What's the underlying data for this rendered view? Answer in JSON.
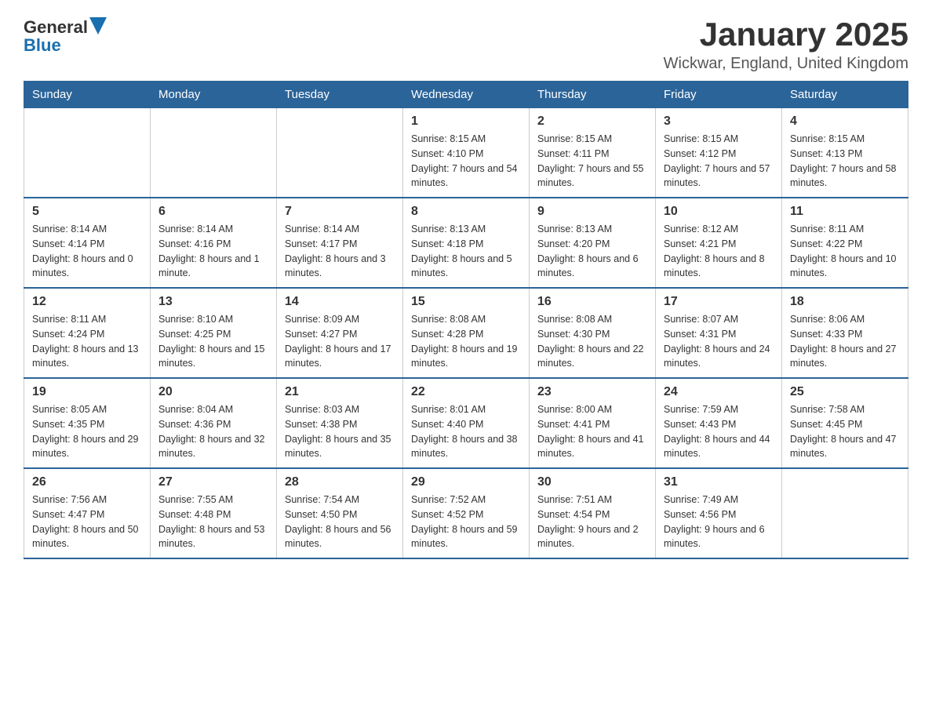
{
  "logo": {
    "text_general": "General",
    "text_blue": "Blue"
  },
  "title": "January 2025",
  "subtitle": "Wickwar, England, United Kingdom",
  "days_of_week": [
    "Sunday",
    "Monday",
    "Tuesday",
    "Wednesday",
    "Thursday",
    "Friday",
    "Saturday"
  ],
  "weeks": [
    [
      {
        "day": "",
        "info": ""
      },
      {
        "day": "",
        "info": ""
      },
      {
        "day": "",
        "info": ""
      },
      {
        "day": "1",
        "info": "Sunrise: 8:15 AM\nSunset: 4:10 PM\nDaylight: 7 hours\nand 54 minutes."
      },
      {
        "day": "2",
        "info": "Sunrise: 8:15 AM\nSunset: 4:11 PM\nDaylight: 7 hours\nand 55 minutes."
      },
      {
        "day": "3",
        "info": "Sunrise: 8:15 AM\nSunset: 4:12 PM\nDaylight: 7 hours\nand 57 minutes."
      },
      {
        "day": "4",
        "info": "Sunrise: 8:15 AM\nSunset: 4:13 PM\nDaylight: 7 hours\nand 58 minutes."
      }
    ],
    [
      {
        "day": "5",
        "info": "Sunrise: 8:14 AM\nSunset: 4:14 PM\nDaylight: 8 hours\nand 0 minutes."
      },
      {
        "day": "6",
        "info": "Sunrise: 8:14 AM\nSunset: 4:16 PM\nDaylight: 8 hours\nand 1 minute."
      },
      {
        "day": "7",
        "info": "Sunrise: 8:14 AM\nSunset: 4:17 PM\nDaylight: 8 hours\nand 3 minutes."
      },
      {
        "day": "8",
        "info": "Sunrise: 8:13 AM\nSunset: 4:18 PM\nDaylight: 8 hours\nand 5 minutes."
      },
      {
        "day": "9",
        "info": "Sunrise: 8:13 AM\nSunset: 4:20 PM\nDaylight: 8 hours\nand 6 minutes."
      },
      {
        "day": "10",
        "info": "Sunrise: 8:12 AM\nSunset: 4:21 PM\nDaylight: 8 hours\nand 8 minutes."
      },
      {
        "day": "11",
        "info": "Sunrise: 8:11 AM\nSunset: 4:22 PM\nDaylight: 8 hours\nand 10 minutes."
      }
    ],
    [
      {
        "day": "12",
        "info": "Sunrise: 8:11 AM\nSunset: 4:24 PM\nDaylight: 8 hours\nand 13 minutes."
      },
      {
        "day": "13",
        "info": "Sunrise: 8:10 AM\nSunset: 4:25 PM\nDaylight: 8 hours\nand 15 minutes."
      },
      {
        "day": "14",
        "info": "Sunrise: 8:09 AM\nSunset: 4:27 PM\nDaylight: 8 hours\nand 17 minutes."
      },
      {
        "day": "15",
        "info": "Sunrise: 8:08 AM\nSunset: 4:28 PM\nDaylight: 8 hours\nand 19 minutes."
      },
      {
        "day": "16",
        "info": "Sunrise: 8:08 AM\nSunset: 4:30 PM\nDaylight: 8 hours\nand 22 minutes."
      },
      {
        "day": "17",
        "info": "Sunrise: 8:07 AM\nSunset: 4:31 PM\nDaylight: 8 hours\nand 24 minutes."
      },
      {
        "day": "18",
        "info": "Sunrise: 8:06 AM\nSunset: 4:33 PM\nDaylight: 8 hours\nand 27 minutes."
      }
    ],
    [
      {
        "day": "19",
        "info": "Sunrise: 8:05 AM\nSunset: 4:35 PM\nDaylight: 8 hours\nand 29 minutes."
      },
      {
        "day": "20",
        "info": "Sunrise: 8:04 AM\nSunset: 4:36 PM\nDaylight: 8 hours\nand 32 minutes."
      },
      {
        "day": "21",
        "info": "Sunrise: 8:03 AM\nSunset: 4:38 PM\nDaylight: 8 hours\nand 35 minutes."
      },
      {
        "day": "22",
        "info": "Sunrise: 8:01 AM\nSunset: 4:40 PM\nDaylight: 8 hours\nand 38 minutes."
      },
      {
        "day": "23",
        "info": "Sunrise: 8:00 AM\nSunset: 4:41 PM\nDaylight: 8 hours\nand 41 minutes."
      },
      {
        "day": "24",
        "info": "Sunrise: 7:59 AM\nSunset: 4:43 PM\nDaylight: 8 hours\nand 44 minutes."
      },
      {
        "day": "25",
        "info": "Sunrise: 7:58 AM\nSunset: 4:45 PM\nDaylight: 8 hours\nand 47 minutes."
      }
    ],
    [
      {
        "day": "26",
        "info": "Sunrise: 7:56 AM\nSunset: 4:47 PM\nDaylight: 8 hours\nand 50 minutes."
      },
      {
        "day": "27",
        "info": "Sunrise: 7:55 AM\nSunset: 4:48 PM\nDaylight: 8 hours\nand 53 minutes."
      },
      {
        "day": "28",
        "info": "Sunrise: 7:54 AM\nSunset: 4:50 PM\nDaylight: 8 hours\nand 56 minutes."
      },
      {
        "day": "29",
        "info": "Sunrise: 7:52 AM\nSunset: 4:52 PM\nDaylight: 8 hours\nand 59 minutes."
      },
      {
        "day": "30",
        "info": "Sunrise: 7:51 AM\nSunset: 4:54 PM\nDaylight: 9 hours\nand 2 minutes."
      },
      {
        "day": "31",
        "info": "Sunrise: 7:49 AM\nSunset: 4:56 PM\nDaylight: 9 hours\nand 6 minutes."
      },
      {
        "day": "",
        "info": ""
      }
    ]
  ]
}
